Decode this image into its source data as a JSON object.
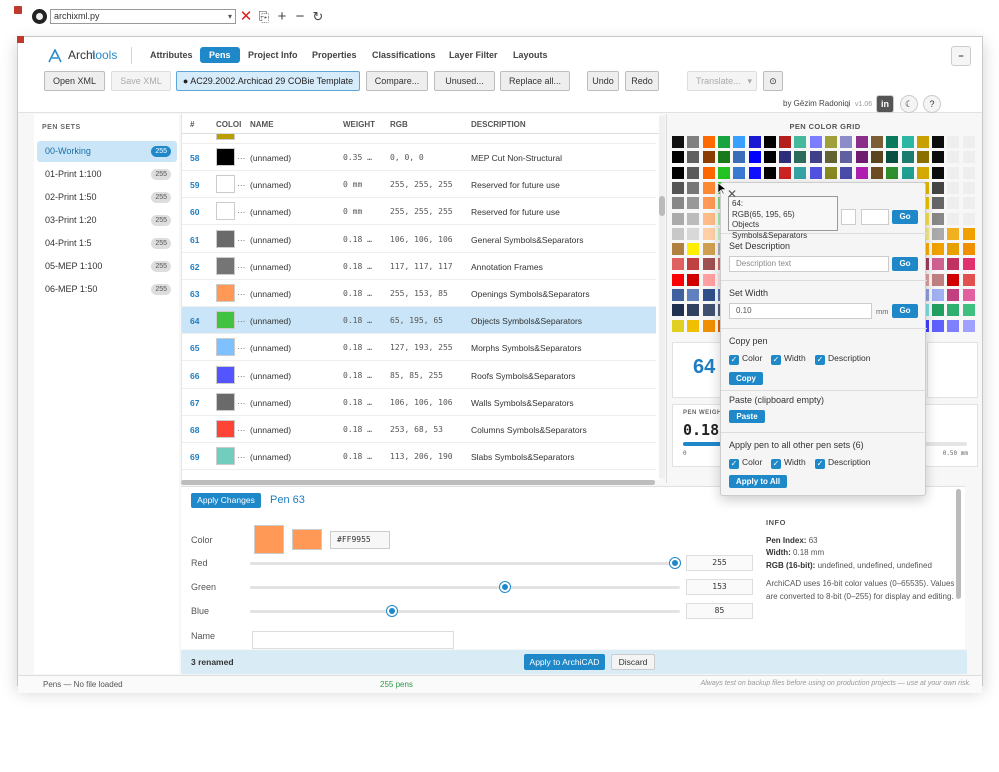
{
  "titlebar": {
    "filename": "archixml.py",
    "dropdown_arrow": "▾",
    "icons": [
      "close-red-icon",
      "file-edit-icon",
      "plus-icon",
      "minus-icon",
      "refresh-icon"
    ]
  },
  "app": {
    "brand_a": "Archi",
    "brand_b": "tools",
    "brand_color": "#1e88c9"
  },
  "nav": {
    "items": [
      "Attributes",
      "Pens",
      "Project Info",
      "Properties",
      "Classifications",
      "Layer Filter",
      "Layouts"
    ],
    "active": "Pens",
    "collapse": "−"
  },
  "toolbar": {
    "open_xml": "Open XML",
    "save_xml": "Save XML",
    "template": "● AC29.2002.Archicad 29 COBie Template",
    "compare": "Compare...",
    "unused": "Unused...",
    "replace_all": "Replace all...",
    "undo": "Undo",
    "redo": "Redo",
    "translate": "Translate...",
    "translate_arrow": "▾",
    "settings": "⊙"
  },
  "byline": {
    "text": "by Gëzim Radoniqi",
    "version": "v1.06",
    "linkedin": "in",
    "theme": "☾",
    "help": "?"
  },
  "sidebar": {
    "title": "PEN SETS",
    "items": [
      {
        "label": "00-Working",
        "count": "255"
      },
      {
        "label": "01-Print 1:100",
        "count": "255"
      },
      {
        "label": "02-Print 1:50",
        "count": "255"
      },
      {
        "label": "03-Print 1:20",
        "count": "255"
      },
      {
        "label": "04-Print 1:5",
        "count": "255"
      },
      {
        "label": "05-MEP 1:100",
        "count": "255"
      },
      {
        "label": "06-MEP 1:50",
        "count": "255"
      }
    ]
  },
  "table": {
    "headers": [
      "#",
      "COLOI",
      "NAME",
      "WEIGHT",
      "RGB",
      "DESCRIPTION"
    ],
    "rows": [
      {
        "num": "58",
        "color": "#000000",
        "name": "(unnamed)",
        "weight": "0.35 …",
        "rgb": "0,  0,  0",
        "desc": "MEP Cut Non-Structural"
      },
      {
        "num": "59",
        "color": "#ffffff",
        "name": "(unnamed)",
        "weight": "0 mm",
        "rgb": "255, 255, 255",
        "desc": "Reserved for future use"
      },
      {
        "num": "60",
        "color": "#ffffff",
        "name": "(unnamed)",
        "weight": "0 mm",
        "rgb": "255, 255, 255",
        "desc": "Reserved for future use"
      },
      {
        "num": "61",
        "color": "#6a6a6a",
        "name": "(unnamed)",
        "weight": "0.18 …",
        "rgb": "106, 106, 106",
        "desc": "General Symbols&Separators"
      },
      {
        "num": "62",
        "color": "#757575",
        "name": "(unnamed)",
        "weight": "0.18 …",
        "rgb": "117, 117, 117",
        "desc": "Annotation Frames"
      },
      {
        "num": "63",
        "color": "#ff9955",
        "name": "(unnamed)",
        "weight": "0.18 …",
        "rgb": "255, 153, 85",
        "desc": "Openings Symbols&Separators"
      },
      {
        "num": "64",
        "color": "#41c341",
        "name": "(unnamed)",
        "weight": "0.18 …",
        "rgb": "65, 195, 65",
        "desc": "Objects Symbols&Separators",
        "selected": true
      },
      {
        "num": "65",
        "color": "#7fc1ff",
        "name": "(unnamed)",
        "weight": "0.18 …",
        "rgb": "127, 193, 255",
        "desc": "Morphs Symbols&Separators"
      },
      {
        "num": "66",
        "color": "#5555ff",
        "name": "(unnamed)",
        "weight": "0.18 …",
        "rgb": "85, 85, 255",
        "desc": "Roofs Symbols&Separators"
      },
      {
        "num": "67",
        "color": "#6a6a6a",
        "name": "(unnamed)",
        "weight": "0.18 …",
        "rgb": "106, 106, 106",
        "desc": "Walls Symbols&Separators"
      },
      {
        "num": "68",
        "color": "#fd4435",
        "name": "(unnamed)",
        "weight": "0.18 …",
        "rgb": "253, 68, 53",
        "desc": "Columns Symbols&Separators"
      },
      {
        "num": "69",
        "color": "#71cebe",
        "name": "(unnamed)",
        "weight": "0.18 …",
        "rgb": "113, 206, 190",
        "desc": "Slabs Symbols&Separators"
      }
    ]
  },
  "grid": {
    "title": "PEN COLOR GRID",
    "colors": [
      "#111111",
      "#808080",
      "#ff6a00",
      "#18a341",
      "#3aa0ff",
      "#1919d2",
      "#000000",
      "#b61e1e",
      "#46b89c",
      "#7d7dff",
      "#a0a03a",
      "#8c8cc8",
      "#8b2d8b",
      "#7b5e36",
      "#0a7a5c",
      "#2bb7a1",
      "#c8a000",
      "#0c0c0c",
      "#eeeeee",
      "#eeeeee",
      "#000000",
      "#606060",
      "#8b3c00",
      "#1a7a1a",
      "#3b6db8",
      "#0000ff",
      "#000000",
      "#2d2d7a",
      "#2b6b5b",
      "#404088",
      "#626233",
      "#6060a0",
      "#701b70",
      "#5b4520",
      "#085040",
      "#1a7d6f",
      "#8b7000",
      "#0c0c0c",
      "#eeeeee",
      "#eeeeee",
      "#000000",
      "#5a5a5a",
      "#ff6600",
      "#22c322",
      "#3a7ad0",
      "#1010ff",
      "#000000",
      "#cc2222",
      "#35a3a3",
      "#5151e0",
      "#888822",
      "#4a4aa8",
      "#b020b0",
      "#6b4c24",
      "#2f8f2f",
      "#20a090",
      "#d4aa00",
      "#0c0c0c",
      "#eeeeee",
      "#eeeeee",
      "#555555",
      "#777777",
      "#ff8833",
      "#41c341",
      "#6aa0e8",
      "#4040ff",
      "#303030",
      "#ff4444",
      "#71cebe",
      "#8080ff",
      "#a8a838",
      "#9b9bd8",
      "#a52aa5",
      "#a07030",
      "#38a038",
      "#30c0a8",
      "#e0b800",
      "#444444",
      "#eeeeee",
      "#eeeeee",
      "#888888",
      "#999999",
      "#ff9955",
      "#88dd88",
      "#7fc1ff",
      "#5555ff",
      "#606060",
      "#fd4435",
      "#8fd8c8",
      "#a0a0ff",
      "#c0c050",
      "#b0b0e0",
      "#c050c0",
      "#b08040",
      "#50c050",
      "#50d0b8",
      "#f0c800",
      "#666666",
      "#eeeeee",
      "#eeeeee",
      "#aaaaaa",
      "#bbbbbb",
      "#ffbb88",
      "#aaeeaa",
      "#a8d4ff",
      "#8888ff",
      "#888888",
      "#ff7766",
      "#b0e8de",
      "#c0c0ff",
      "#d8d878",
      "#c8c8f0",
      "#d880d8",
      "#c8a068",
      "#80d880",
      "#80e0cc",
      "#f8e050",
      "#888888",
      "#eeeeee",
      "#eeeeee",
      "#c8c8c8",
      "#d8d8d8",
      "#ffd0a8",
      "#c8f4c8",
      "#c8e4ff",
      "#aaaaff",
      "#aaaaaa",
      "#ff9988",
      "#cceee8",
      "#d8d8ff",
      "#e8e8a0",
      "#ddddf8",
      "#e8a8e8",
      "#d8bc90",
      "#a8e8a8",
      "#a8eee0",
      "#f8ec88",
      "#aaaaaa",
      "#f0b020",
      "#f0a000",
      "#b08040",
      "#ffee00",
      "#d0a050",
      "#b0b0b0",
      "#d8d040",
      "#60c060",
      "#d8a0a0",
      "#e0d880",
      "#805020",
      "#e09090",
      "#a06080",
      "#f0c040",
      "#f08030",
      "#f0b040",
      "#ff8000",
      "#ffaa30",
      "#ffb000",
      "#f0a000",
      "#e8a000",
      "#f09000",
      "#e06060",
      "#c04040",
      "#a05050",
      "#d07070",
      "#40a0c0",
      "#2080a0",
      "#a0d0e0",
      "#80c0e0",
      "#4060c0",
      "#6080d0",
      "#e0e0e0",
      "#a0a0c0",
      "#8060a0",
      "#c04070",
      "#e08090",
      "#e0a0c0",
      "#a04060",
      "#d06090",
      "#c03060",
      "#e03070",
      "#ff0000",
      "#d00000",
      "#ffa0a0",
      "#ffe0e0",
      "#c08080",
      "#e0c0c0",
      "#e08080",
      "#a00000",
      "#c04040",
      "#f06060",
      "#d04040",
      "#ff8080",
      "#f0a0a0",
      "#e06060",
      "#c00000",
      "#ffc0c0",
      "#e0a0a0",
      "#c08080",
      "#d00000",
      "#e05050",
      "#4060a0",
      "#6080c0",
      "#30508a",
      "#5070b0",
      "#203870",
      "#8090c0",
      "#8050a0",
      "#a070c0",
      "#c090e0",
      "#7050a0",
      "#6040a0",
      "#5030a0",
      "#304080",
      "#405090",
      "#6070b0",
      "#8090d0",
      "#90a0e0",
      "#a0b0f0",
      "#c04080",
      "#e060a0",
      "#203050",
      "#304060",
      "#405070",
      "#506080",
      "#206080",
      "#307090",
      "#4080a0",
      "#5090b0",
      "#60a0c0",
      "#70b0d0",
      "#208080",
      "#309090",
      "#40a0a0",
      "#50b0b0",
      "#60c0c0",
      "#70d0d0",
      "#80e0e0",
      "#20a060",
      "#30b070",
      "#40c080",
      "#e0d020",
      "#f0c000",
      "#f09000",
      "#e06000",
      "#d04000",
      "#c02000",
      "#b00000",
      "#a00020",
      "#900040",
      "#800060",
      "#700080",
      "#6000a0",
      "#5000c0",
      "#4000e0",
      "#3000f0",
      "#2020ff",
      "#4040ff",
      "#6060ff",
      "#8080ff",
      "#a0a0ff"
    ],
    "selected_index": "64",
    "weight_label": "PEN WEIGHT",
    "weight_value": "0.18",
    "weight_fraction": 0.36,
    "weight_min": "0",
    "weight_max": "0.50 mm"
  },
  "tooltip": {
    "line1": "64:",
    "line2": "RGB(65, 195, 65)",
    "line3": "Objects Symbols&Separators"
  },
  "popup": {
    "go": "Go",
    "set_description_label": "Set Description",
    "description_placeholder": "Description text",
    "set_width_label": "Set Width",
    "width_value": "0.10",
    "width_unit": "mm",
    "copy_label": "Copy pen",
    "cb_color": "Color",
    "cb_width": "Width",
    "cb_description": "Description",
    "copy_btn": "Copy",
    "paste_label": "Paste (clipboard empty)",
    "paste_btn": "Paste",
    "apply_all_label": "Apply pen to all other pen sets (6)",
    "apply_all_btn": "Apply to All",
    "check": "✓",
    "close": "✕"
  },
  "editor": {
    "apply": "Apply Changes",
    "pen_title": "Pen 63",
    "color_label": "Color",
    "hex": "#FF9955",
    "swatch": "#ff9955",
    "red_label": "Red",
    "red": "255",
    "green_label": "Green",
    "green": "153",
    "blue_label": "Blue",
    "blue": "85",
    "name_label": "Name",
    "info_title": "INFO",
    "info_pen_index_k": "Pen Index:",
    "info_pen_index_v": "63",
    "info_width_k": "Width:",
    "info_width_v": "0.18 mm",
    "info_rgb16_k": "RGB (16-bit):",
    "info_rgb16_v": "undefined, undefined, undefined",
    "info_note": "ArchiCAD uses 16-bit color values (0–65535). Values are converted to 8-bit (0–255) for display and editing."
  },
  "bottombar": {
    "renamed": "3 renamed",
    "apply": "Apply to ArchiCAD",
    "discard": "Discard"
  },
  "status": {
    "left": "Pens — No file loaded",
    "mid": "255 pens",
    "right": "Always test on backup files before using on production projects — use at your own risk."
  }
}
